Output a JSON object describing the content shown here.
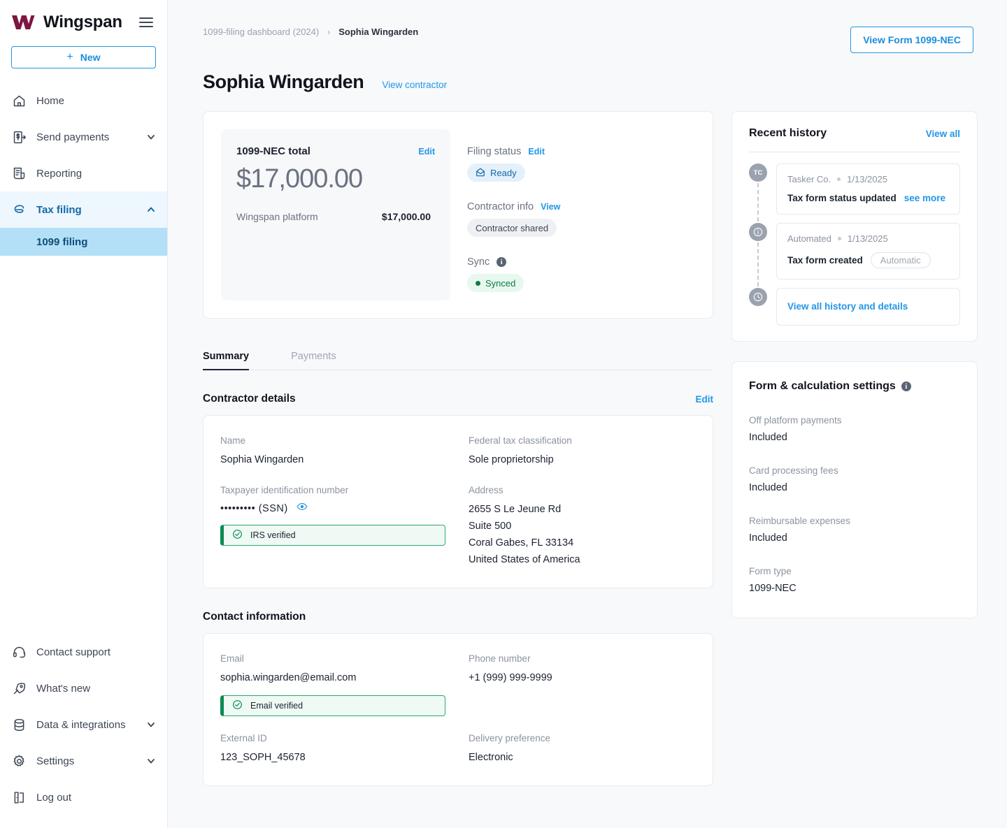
{
  "brand": {
    "name": "Wingspan",
    "logo_icon": "wingspan-logo",
    "menu_icon": "hamburger-icon"
  },
  "sidebar": {
    "new_button": {
      "label": "New",
      "icon": "plus-icon"
    },
    "items": [
      {
        "label": "Home",
        "icon": "home-icon",
        "expandable": false
      },
      {
        "label": "Send payments",
        "icon": "send-payment-icon",
        "expandable": true
      },
      {
        "label": "Reporting",
        "icon": "reporting-icon",
        "expandable": false
      },
      {
        "label": "Tax filing",
        "icon": "tax-filing-icon",
        "expandable": true,
        "active": true
      }
    ],
    "sub_items": [
      {
        "label": "1099 filing",
        "active": true
      }
    ],
    "bottom_items": [
      {
        "label": "Contact support",
        "icon": "headset-icon",
        "expandable": false
      },
      {
        "label": "What's new",
        "icon": "rocket-icon",
        "expandable": false
      },
      {
        "label": "Data & integrations",
        "icon": "database-icon",
        "expandable": true
      },
      {
        "label": "Settings",
        "icon": "gear-icon",
        "expandable": true
      },
      {
        "label": "Log out",
        "icon": "logout-icon",
        "expandable": false
      }
    ]
  },
  "header": {
    "breadcrumb": {
      "parent": "1099-filing dashboard (2024)",
      "separator": "›",
      "current": "Sophia Wingarden"
    },
    "view_form_button": "View Form 1099-NEC",
    "page_title": "Sophia Wingarden",
    "view_contractor_link": "View contractor"
  },
  "summary_card": {
    "total_label": "1099-NEC total",
    "edit_label": "Edit",
    "total_amount": "$17,000.00",
    "breakdown_label": "Wingspan platform",
    "breakdown_value": "$17,000.00",
    "filing_status": {
      "label": "Filing status",
      "action": "Edit",
      "badge": "Ready",
      "badge_icon": "envelope-open-icon"
    },
    "contractor_info": {
      "label": "Contractor info",
      "action": "View",
      "badge": "Contractor shared"
    },
    "sync": {
      "label": "Sync",
      "info_icon": "info-icon",
      "badge": "Synced"
    }
  },
  "tabs": [
    {
      "label": "Summary",
      "active": true
    },
    {
      "label": "Payments",
      "active": false
    }
  ],
  "contractor_details": {
    "section_title": "Contractor details",
    "edit_label": "Edit",
    "name_label": "Name",
    "name_value": "Sophia Wingarden",
    "classification_label": "Federal tax classification",
    "classification_value": "Sole proprietorship",
    "tin_label": "Taxpayer identification number",
    "tin_value": "••••••••• (SSN)",
    "tin_reveal_icon": "eye-icon",
    "tin_banner": "IRS verified",
    "tin_banner_icon": "check-circle-icon",
    "address_label": "Address",
    "address_lines": [
      "2655 S Le Jeune Rd",
      "Suite 500",
      "Coral Gabes, FL 33134",
      "United States of America"
    ]
  },
  "contact_information": {
    "section_title": "Contact information",
    "email_label": "Email",
    "email_value": "sophia.wingarden@email.com",
    "email_banner": "Email verified",
    "email_banner_icon": "check-circle-icon",
    "phone_label": "Phone number",
    "phone_value": "+1 (999) 999-9999",
    "external_id_label": "External ID",
    "external_id_value": "123_SOPH_45678",
    "delivery_label": "Delivery preference",
    "delivery_value": "Electronic"
  },
  "recent_history": {
    "title": "Recent history",
    "view_all": "View all",
    "entries": [
      {
        "avatar": "TC",
        "avatar_icon": "initials-avatar",
        "actor": "Tasker Co.",
        "date": "1/13/2025",
        "text": "Tax form status updated",
        "link": "see more"
      },
      {
        "avatar": "i",
        "avatar_icon": "info-circle-icon",
        "actor": "Automated",
        "date": "1/13/2025",
        "text": "Tax form created",
        "chip": "Automatic"
      }
    ],
    "footer_link": {
      "label": "View all history and details",
      "avatar_icon": "clock-icon"
    }
  },
  "form_settings": {
    "title": "Form & calculation settings",
    "info_icon": "info-icon",
    "rows": [
      {
        "label": "Off platform payments",
        "value": "Included"
      },
      {
        "label": "Card processing fees",
        "value": "Included"
      },
      {
        "label": "Reimbursable expenses",
        "value": "Included"
      },
      {
        "label": "Form type",
        "value": "1099-NEC"
      }
    ]
  },
  "colors": {
    "brand_maroon": "#7d1641",
    "accent_blue": "#2196e8",
    "active_nav_bg": "#b3e0f7",
    "success_green": "#0a8a51",
    "page_bg": "#f7f9fb"
  }
}
